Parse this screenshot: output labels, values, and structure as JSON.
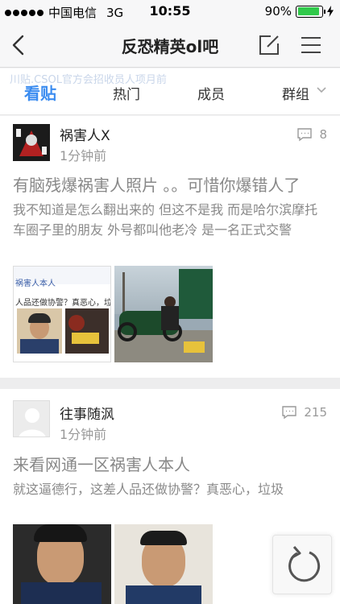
{
  "status": {
    "carrier": "中国电信",
    "network": "3G",
    "time": "10:55",
    "battery": "90%",
    "battery_level": 0.9
  },
  "nav": {
    "title": "反恐精英ol吧"
  },
  "tabs": {
    "ghost_text": "川贴.CSOL官方会招收员人项月前",
    "items": [
      "看贴",
      "热门",
      "成员",
      "群组"
    ]
  },
  "posts": [
    {
      "author": "祸害人X",
      "time": "1分钟前",
      "comments": "8",
      "title": "有脑残爆祸害人照片 。。可惜你爆错人了",
      "body": "我不知道是怎么翻出来的 但这不是我 而是哈尔滨摩托车圈子里的朋友 外号都叫他老冷 是一名正式交警",
      "img_caption_1": "祸害人本人",
      "img_caption_2": "人品还做协警？真恶心，垃圾"
    },
    {
      "author": "往事随沨",
      "time": "1分钟前",
      "comments": "215",
      "title": "来看网通一区祸害人本人",
      "body": "就这逼德行，这差人品还做协警？真恶心，垃圾"
    }
  ]
}
